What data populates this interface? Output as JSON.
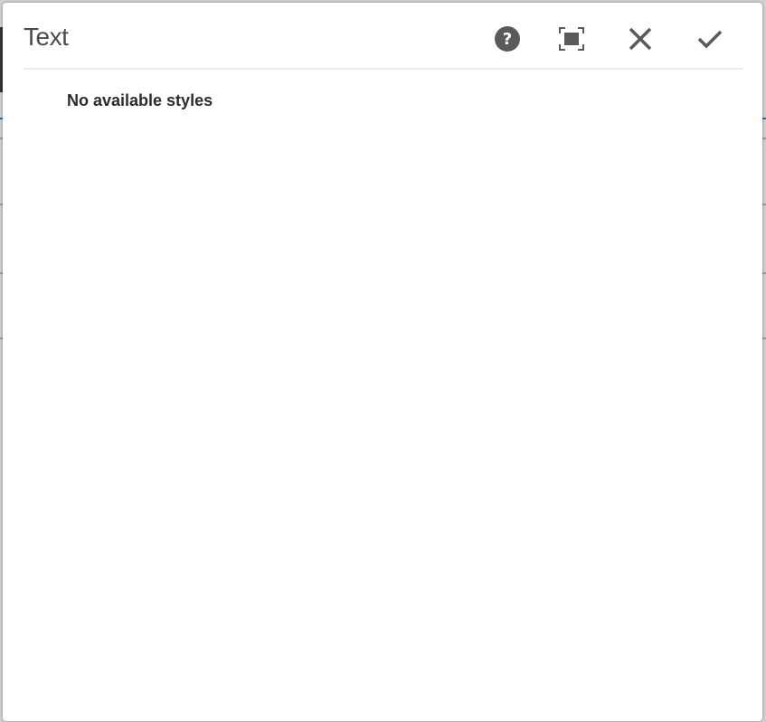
{
  "dialog": {
    "title": "Text",
    "message": "No available styles"
  },
  "actions": {
    "help": "help-icon",
    "fullscreen": "fullscreen-icon",
    "close": "close-icon",
    "done": "checkmark-icon"
  },
  "colors": {
    "icon": "#5a5a5a",
    "title": "#4b4b4b",
    "text": "#2c2c2c",
    "divider": "#ececec"
  }
}
